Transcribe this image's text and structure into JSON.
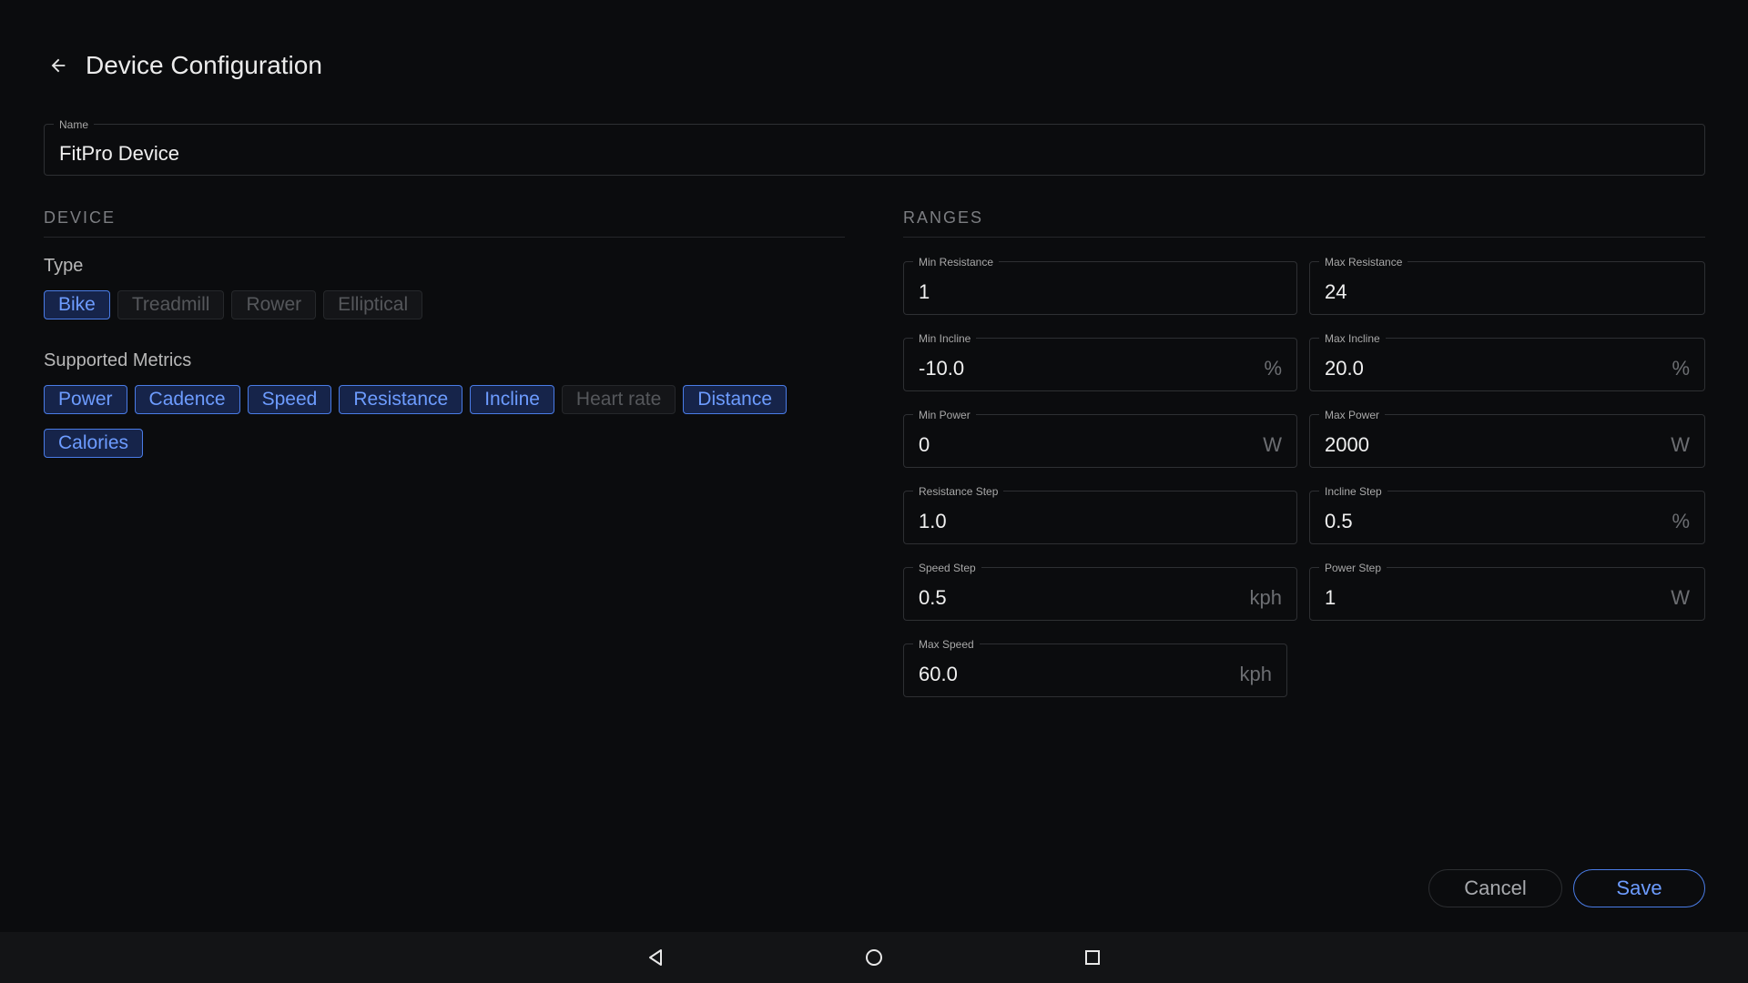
{
  "header": {
    "title": "Device Configuration"
  },
  "name_field": {
    "label": "Name",
    "value": "FitPro Device"
  },
  "device_section": {
    "title": "DEVICE",
    "type_label": "Type",
    "types": [
      {
        "label": "Bike",
        "selected": true
      },
      {
        "label": "Treadmill",
        "selected": false
      },
      {
        "label": "Rower",
        "selected": false
      },
      {
        "label": "Elliptical",
        "selected": false
      }
    ],
    "metrics_label": "Supported Metrics",
    "metrics": [
      {
        "label": "Power",
        "selected": true
      },
      {
        "label": "Cadence",
        "selected": true
      },
      {
        "label": "Speed",
        "selected": true
      },
      {
        "label": "Resistance",
        "selected": true
      },
      {
        "label": "Incline",
        "selected": true
      },
      {
        "label": "Heart rate",
        "selected": false
      },
      {
        "label": "Distance",
        "selected": true
      },
      {
        "label": "Calories",
        "selected": true
      }
    ]
  },
  "ranges_section": {
    "title": "RANGES",
    "fields": {
      "min_resistance": {
        "label": "Min Resistance",
        "value": "1",
        "suffix": ""
      },
      "max_resistance": {
        "label": "Max Resistance",
        "value": "24",
        "suffix": ""
      },
      "min_incline": {
        "label": "Min Incline",
        "value": "-10.0",
        "suffix": "%"
      },
      "max_incline": {
        "label": "Max Incline",
        "value": "20.0",
        "suffix": "%"
      },
      "min_power": {
        "label": "Min Power",
        "value": "0",
        "suffix": "W"
      },
      "max_power": {
        "label": "Max Power",
        "value": "2000",
        "suffix": "W"
      },
      "resistance_step": {
        "label": "Resistance Step",
        "value": "1.0",
        "suffix": ""
      },
      "incline_step": {
        "label": "Incline Step",
        "value": "0.5",
        "suffix": "%"
      },
      "speed_step": {
        "label": "Speed Step",
        "value": "0.5",
        "suffix": "kph"
      },
      "power_step": {
        "label": "Power Step",
        "value": "1",
        "suffix": "W"
      },
      "max_speed": {
        "label": "Max Speed",
        "value": "60.0",
        "suffix": "kph"
      }
    }
  },
  "actions": {
    "cancel_label": "Cancel",
    "save_label": "Save"
  },
  "colors": {
    "background": "#0b0c0e",
    "accent": "#6d9cff",
    "chip_selected_bg": "#16244a",
    "navbar": "#131416"
  },
  "navbar": {
    "icons": [
      "back-triangle-icon",
      "home-circle-icon",
      "recents-square-icon"
    ]
  }
}
